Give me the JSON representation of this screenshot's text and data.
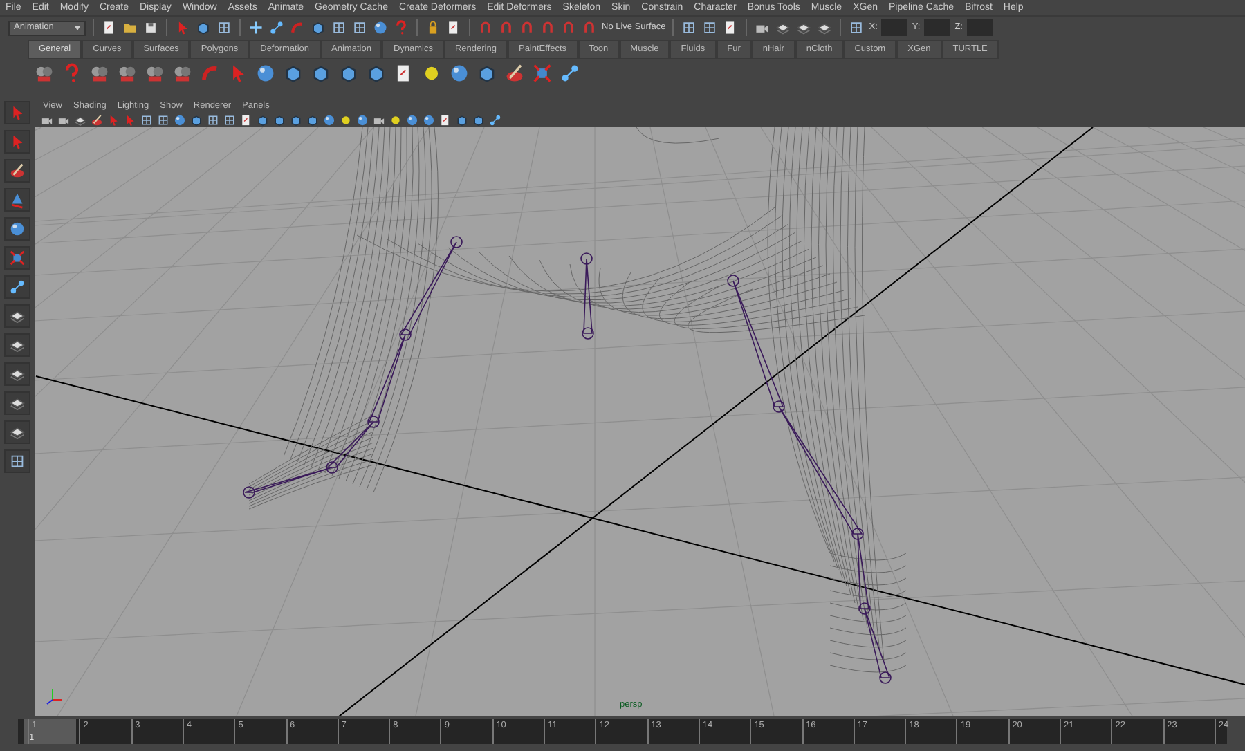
{
  "menu_bar": [
    "File",
    "Edit",
    "Modify",
    "Create",
    "Display",
    "Window",
    "Assets",
    "Animate",
    "Geometry Cache",
    "Create Deformers",
    "Edit Deformers",
    "Skeleton",
    "Skin",
    "Constrain",
    "Character",
    "Bonus Tools",
    "Muscle",
    "XGen",
    "Pipeline Cache",
    "Bifrost",
    "Help"
  ],
  "status_line": {
    "mode": "Animation",
    "live_surface": "No Live Surface",
    "coordinates": [
      {
        "label": "X:"
      },
      {
        "label": "Y:"
      },
      {
        "label": "Z:"
      }
    ]
  },
  "shelf_tabs": [
    {
      "label": "General",
      "selected": true
    },
    {
      "label": "Curves",
      "selected": false
    },
    {
      "label": "Surfaces",
      "selected": false
    },
    {
      "label": "Polygons",
      "selected": false
    },
    {
      "label": "Deformation",
      "selected": false
    },
    {
      "label": "Animation",
      "selected": false
    },
    {
      "label": "Dynamics",
      "selected": false
    },
    {
      "label": "Rendering",
      "selected": false
    },
    {
      "label": "PaintEffects",
      "selected": false
    },
    {
      "label": "Toon",
      "selected": false
    },
    {
      "label": "Muscle",
      "selected": false
    },
    {
      "label": "Fluids",
      "selected": false
    },
    {
      "label": "Fur",
      "selected": false
    },
    {
      "label": "nHair",
      "selected": false
    },
    {
      "label": "nCloth",
      "selected": false
    },
    {
      "label": "Custom",
      "selected": false
    },
    {
      "label": "XGen",
      "selected": false
    },
    {
      "label": "TURTLE",
      "selected": false
    }
  ],
  "viewport": {
    "menus": [
      "View",
      "Shading",
      "Lighting",
      "Show",
      "Renderer",
      "Panels"
    ],
    "camera": "persp"
  },
  "timeline": {
    "level": 0,
    "ticks": [
      "1",
      "2",
      "3",
      "4",
      "5",
      "6",
      "7",
      "8",
      "9",
      "10",
      "11",
      "12",
      "13",
      "14",
      "15",
      "16",
      "17",
      "18",
      "19",
      "20",
      "21",
      "22",
      "23",
      "24"
    ],
    "current_frame": "1"
  }
}
